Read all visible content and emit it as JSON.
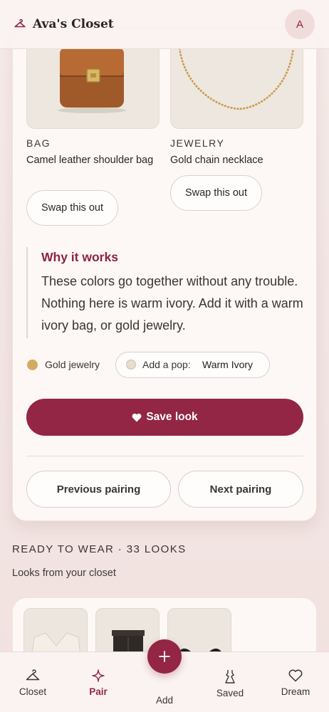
{
  "header": {
    "title": "Ava's Closet",
    "avatar_initial": "A"
  },
  "pairing": {
    "items": [
      {
        "category": "BAG",
        "name": "Camel leather shoulder bag",
        "swap_label": "Swap this out",
        "image_icon": "shoulder-bag"
      },
      {
        "category": "JEWELRY",
        "name": "Gold chain necklace",
        "swap_label": "Swap this out",
        "image_icon": "chain-necklace"
      }
    ],
    "why": {
      "title": "Why it works",
      "text": "These colors go together without any trouble. Nothing here is warm ivory. Add it with a warm ivory bag, or gold jewelry."
    },
    "chips": {
      "gold": {
        "label": "Gold jewelry",
        "color": "#d4ab62"
      },
      "pop": {
        "prefix": "Add a pop:",
        "value": "Warm Ivory",
        "color": "#e6dfcc"
      }
    },
    "save_label": "Save look",
    "prev_label": "Previous pairing",
    "next_label": "Next pairing"
  },
  "ready": {
    "title": "READY TO WEAR · 33 LOOKS",
    "subtitle": "Looks from your closet"
  },
  "bottom_nav": {
    "closet": "Closet",
    "pair": "Pair",
    "add": "Add",
    "saved": "Saved",
    "dream": "Dream"
  },
  "colors": {
    "accent": "#932545",
    "background": "#f6ece9",
    "card": "#fdf8f6"
  }
}
